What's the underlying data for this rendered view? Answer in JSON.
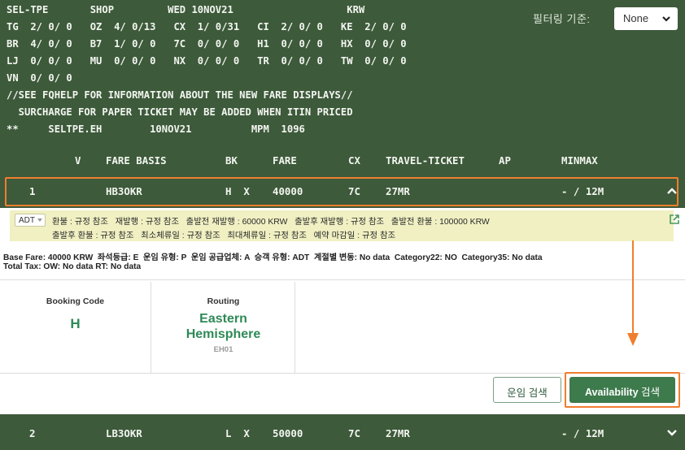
{
  "terminal": {
    "lines": [
      "SEL-TPE       SHOP         WED 10NOV21                   KRW",
      "TG  2/ 0/ 0   OZ  4/ 0/13   CX  1/ 0/31   CI  2/ 0/ 0   KE  2/ 0/ 0",
      "BR  4/ 0/ 0   B7  1/ 0/ 0   7C  0/ 0/ 0   H1  0/ 0/ 0   HX  0/ 0/ 0",
      "LJ  0/ 0/ 0   MU  0/ 0/ 0   NX  0/ 0/ 0   TR  0/ 0/ 0   TW  0/ 0/ 0",
      "VN  0/ 0/ 0",
      "//SEE FQHELP FOR INFORMATION ABOUT THE NEW FARE DISPLAYS//",
      "  SURCHARGE FOR PAPER TICKET MAY BE ADDED WHEN ITIN PRICED",
      "**     SELTPE.EH        10NOV21          MPM  1096"
    ]
  },
  "filter": {
    "label": "필터링 기준:",
    "value": "None"
  },
  "columns": {
    "v": "V",
    "fare_basis": "FARE BASIS",
    "bk": "BK",
    "fare": "FARE",
    "cx": "CX",
    "travel_ticket": "TRAVEL-TICKET",
    "ap": "AP",
    "minmax": "MINMAX"
  },
  "rows": [
    {
      "num": "1",
      "fare_basis": "HB3OKR",
      "bk": "H  X",
      "fare": "40000",
      "cx": "7C",
      "travel_ticket": "27MR",
      "minmax": "- / 12M"
    },
    {
      "num": "2",
      "fare_basis": "LB3OKR",
      "bk": "L  X",
      "fare": "50000",
      "cx": "7C",
      "travel_ticket": "27MR",
      "minmax": "- / 12M"
    }
  ],
  "detail": {
    "pax_type": "ADT",
    "rules_line1": "환불 : 규정 참조   재발행 : 규정 참조   출발전 재발행 : 60000 KRW   출발후 재발행 : 규정 참조   출발전 환불 : 100000 KRW",
    "rules_line2": "출발후 환불 : 규정 참조   최소체류일 : 규정 참조   최대체류일 : 규정 참조   예약 마감일 : 규정 참조",
    "info_line1": "Base Fare: 40000 KRW  좌석등급: E  운임 유형: P  운임 공급업체: A  승객 유형: ADT  계절별 변동: No data  Category22: NO  Category35: No data",
    "info_line2": "Total Tax: OW: No data RT: No data",
    "booking_code_label": "Booking Code",
    "booking_code": "H",
    "routing_label": "Routing",
    "routing_line1": "Eastern",
    "routing_line2": "Hemisphere",
    "routing_code": "EH01",
    "fare_search_button": "운임 검색",
    "availability_button_bold": "Availability",
    "availability_button_rest": " 검색"
  },
  "colors": {
    "terminal_bg": "#3d5a3a",
    "accent_orange": "#f07e2e",
    "green_text": "#2e8a57",
    "rules_bg": "#f0f0c3"
  }
}
